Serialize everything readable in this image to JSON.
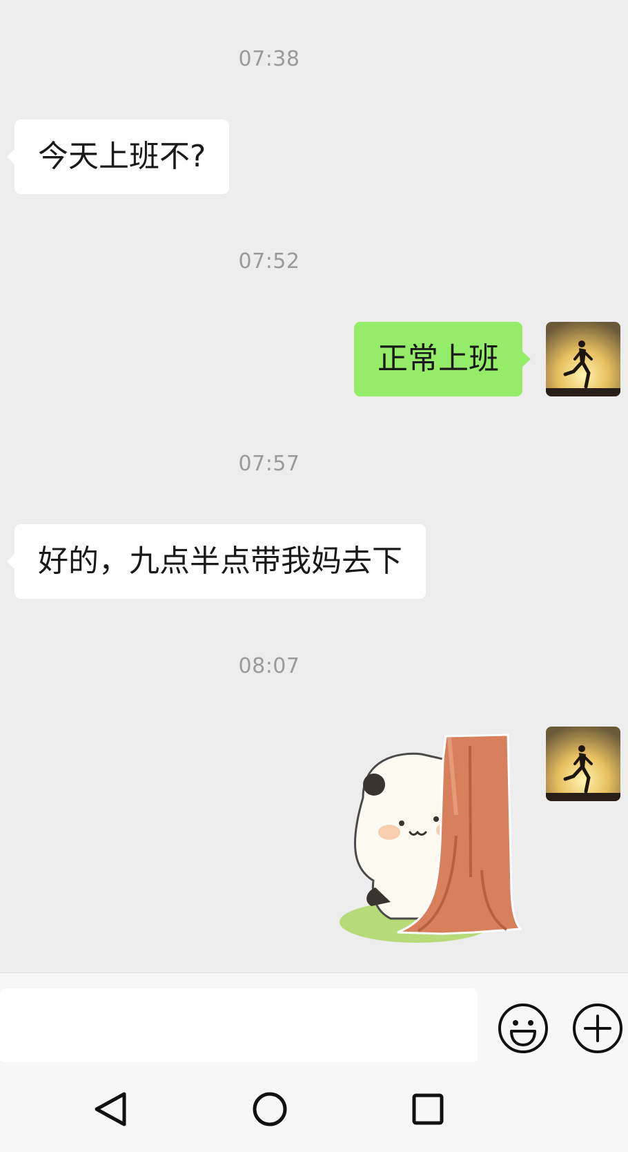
{
  "messages": [
    {
      "time": "07:38",
      "side": "incoming",
      "text": "今天上班不?"
    },
    {
      "time": "07:52",
      "side": "outgoing",
      "text": "正常上班"
    },
    {
      "time": "07:57",
      "side": "incoming",
      "text": "好的，九点半点带我妈去下"
    },
    {
      "time": "08:07",
      "side": "outgoing",
      "sticker": "panda-peeking-behind-tree-sticker"
    }
  ],
  "input_bar": {
    "value": "",
    "emoji_icon": "emoji-smile-icon",
    "plus_icon": "plus-circle-icon"
  },
  "nav_bar": {
    "back_icon": "back-triangle-icon",
    "home_icon": "home-circle-icon",
    "recents_icon": "recents-square-icon"
  },
  "colors": {
    "chat_background": "#ededed",
    "incoming_bubble": "#ffffff",
    "outgoing_bubble": "#95ec69",
    "timestamp_text": "#9a9a9a"
  }
}
